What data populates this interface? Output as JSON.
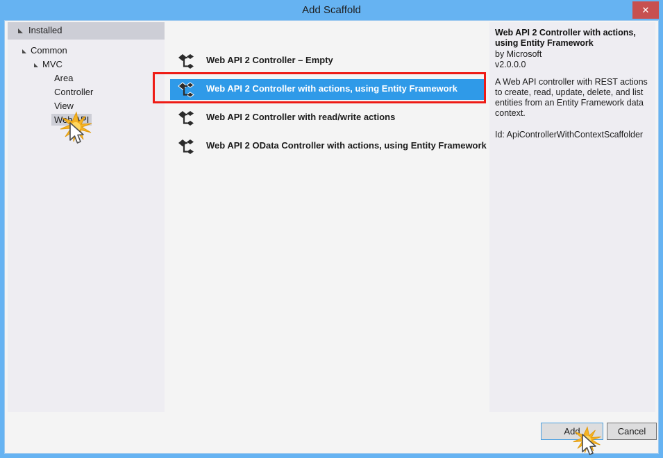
{
  "window": {
    "title": "Add Scaffold",
    "close_label": "✕",
    "accent_blue": "#66b3f2",
    "close_red": "#c75050",
    "selection_blue": "#2f9ae8",
    "highlight_red": "#ee1b15"
  },
  "sidebar": {
    "header": "Installed",
    "tree": [
      {
        "label": "Common",
        "level": 1,
        "expanded": true,
        "selected": false
      },
      {
        "label": "MVC",
        "level": 2,
        "expanded": true,
        "selected": false
      },
      {
        "label": "Area",
        "level": 3,
        "expanded": false,
        "selected": false
      },
      {
        "label": "Controller",
        "level": 3,
        "expanded": false,
        "selected": false
      },
      {
        "label": "View",
        "level": 3,
        "expanded": false,
        "selected": false
      },
      {
        "label": "Web API",
        "level": 3,
        "expanded": false,
        "selected": true
      }
    ]
  },
  "list": {
    "icon_name": "scaffold-branch-icon",
    "items": [
      {
        "label": "Web API 2 Controller – Empty",
        "selected": false
      },
      {
        "label": "Web API 2 Controller with actions, using Entity Framework",
        "selected": true
      },
      {
        "label": "Web API 2 Controller with read/write actions",
        "selected": false
      },
      {
        "label": "Web API 2 OData Controller with actions, using Entity Framework",
        "selected": false
      }
    ]
  },
  "details": {
    "title": "Web API 2 Controller with actions, using Entity Framework",
    "author": "by Microsoft",
    "version": "v2.0.0.0",
    "description": "A Web API controller with REST actions to create, read, update, delete, and list entities from an Entity Framework data context.",
    "id": "Id: ApiControllerWithContextScaffolder"
  },
  "footer": {
    "add_label": "Add",
    "cancel_label": "Cancel"
  }
}
